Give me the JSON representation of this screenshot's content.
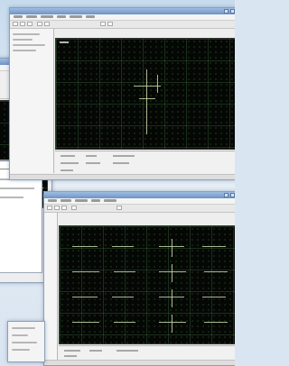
{
  "screenshot": {
    "description_free": true
  },
  "windows": {
    "back_window": {
      "panels": [
        "toolbar",
        "plot",
        "dialog"
      ]
    },
    "top_window": {
      "panels": [
        "titlebar",
        "menubar",
        "toolbar",
        "sidebar",
        "plot",
        "status"
      ]
    },
    "bottom_window": {
      "panels": [
        "titlebar",
        "menubar",
        "toolbar",
        "sidebar",
        "plot",
        "status"
      ]
    }
  },
  "colors": {
    "plot_background": "#050705",
    "grid": "#2f6b2f",
    "trace": "#c9d6a8",
    "titlebar": "#6e93c4",
    "desktop": "#d9e6f1"
  },
  "icons": {
    "minimize": "minimize-icon",
    "maximize": "maximize-icon",
    "close": "close-icon"
  }
}
